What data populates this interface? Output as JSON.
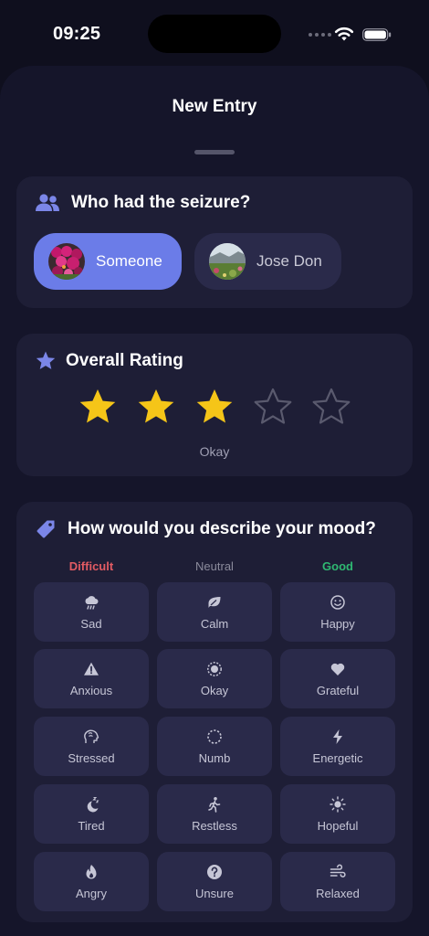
{
  "status_bar": {
    "time": "09:25"
  },
  "sheet": {
    "title": "New Entry"
  },
  "who": {
    "title": "Who had the seizure?",
    "people": [
      {
        "name": "Someone",
        "selected": true
      },
      {
        "name": "Jose Don",
        "selected": false
      }
    ]
  },
  "rating": {
    "title": "Overall Rating",
    "value": 3,
    "max": 5,
    "caption": "Okay"
  },
  "mood": {
    "title": "How would you describe your mood?",
    "columns": [
      "Difficult",
      "Neutral",
      "Good"
    ],
    "options": [
      [
        "Sad",
        "Calm",
        "Happy"
      ],
      [
        "Anxious",
        "Okay",
        "Grateful"
      ],
      [
        "Stressed",
        "Numb",
        "Energetic"
      ],
      [
        "Tired",
        "Restless",
        "Hopeful"
      ],
      [
        "Angry",
        "Unsure",
        "Relaxed"
      ]
    ]
  },
  "colors": {
    "background": "#0f0f1e",
    "sheet": "#15152a",
    "card": "#1e1e36",
    "chip": "#2a2a4a",
    "accent": "#6b7ce8",
    "star": "#f5c518",
    "difficult": "#e25b63",
    "good": "#2fb872"
  }
}
